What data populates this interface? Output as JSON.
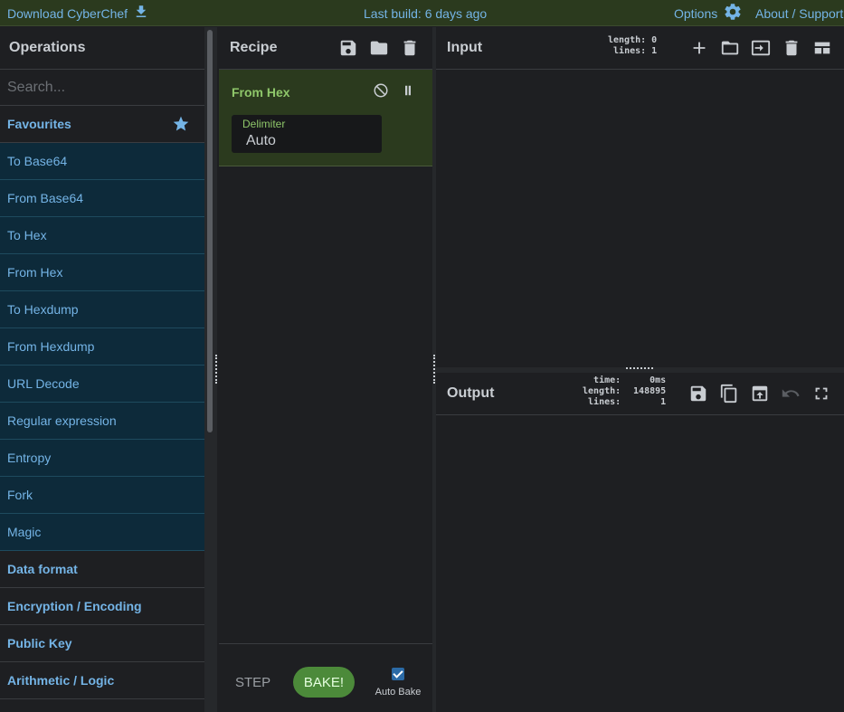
{
  "topbar": {
    "download": "Download CyberChef",
    "build": "Last build: 6 days ago",
    "options": "Options",
    "about": "About / Support"
  },
  "operations": {
    "title": "Operations",
    "search_placeholder": "Search...",
    "favourites": "Favourites",
    "items": [
      "To Base64",
      "From Base64",
      "To Hex",
      "From Hex",
      "To Hexdump",
      "From Hexdump",
      "URL Decode",
      "Regular expression",
      "Entropy",
      "Fork",
      "Magic"
    ],
    "categories": [
      "Data format",
      "Encryption / Encoding",
      "Public Key",
      "Arithmetic / Logic"
    ]
  },
  "recipe": {
    "title": "Recipe",
    "operation": {
      "name": "From Hex",
      "delimiter_label": "Delimiter",
      "delimiter_value": "Auto"
    },
    "step_label": "STEP",
    "bake_label": "BAKE!",
    "autobake_label": "Auto Bake",
    "autobake_checked": true
  },
  "input": {
    "title": "Input",
    "length_label": "length:",
    "length_value": "0",
    "lines_label": "lines:",
    "lines_value": "1"
  },
  "output": {
    "title": "Output",
    "time_label": "time:",
    "time_value": "0ms",
    "length_label": "length:",
    "length_value": "148895",
    "lines_label": "lines:",
    "lines_value": "1"
  },
  "colors": {
    "accent": "#74b4e6",
    "recipe_card": "#2b3a1e",
    "bake_button": "#4c8a3a"
  }
}
